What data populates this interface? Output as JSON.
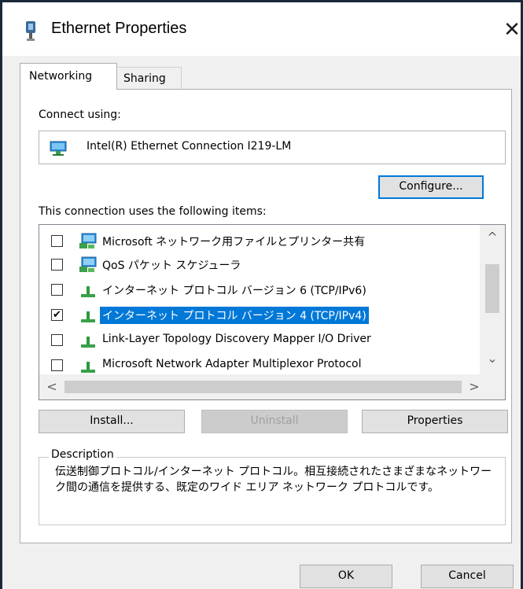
{
  "window": {
    "title": "Ethernet Properties",
    "close_glyph": "✕"
  },
  "tabs": [
    {
      "label": "Networking",
      "active": true
    },
    {
      "label": "Sharing",
      "active": false
    }
  ],
  "connect_using": {
    "label": "Connect using:",
    "adapter_name": "Intel(R) Ethernet Connection I219-LM",
    "adapter_icon": "network-adapter-icon",
    "configure_label": "Configure..."
  },
  "items_section": {
    "label": "This connection uses the following items:",
    "items": [
      {
        "label": "Microsoft ネットワーク用ファイルとプリンター共有",
        "checked": false,
        "icon": "network-service-icon",
        "selected": false
      },
      {
        "label": "QoS パケット スケジューラ",
        "checked": false,
        "icon": "network-service-icon",
        "selected": false
      },
      {
        "label": "インターネット プロトコル バージョン 6 (TCP/IPv6)",
        "checked": false,
        "icon": "protocol-icon",
        "selected": false
      },
      {
        "label": "インターネット プロトコル バージョン 4 (TCP/IPv4)",
        "checked": true,
        "icon": "protocol-icon",
        "selected": true
      },
      {
        "label": "Link-Layer Topology Discovery Mapper I/O Driver",
        "checked": false,
        "icon": "protocol-icon",
        "selected": false
      },
      {
        "label": "Microsoft Network Adapter Multiplexor Protocol",
        "checked": false,
        "icon": "protocol-icon",
        "selected": false
      }
    ],
    "check_glyph": "✔",
    "scroll_up_glyph": "^",
    "scroll_down_glyph": "⌄",
    "scroll_left_glyph": "<",
    "scroll_right_glyph": ">"
  },
  "actions": {
    "install_label": "Install...",
    "uninstall_label": "Uninstall",
    "properties_label": "Properties"
  },
  "description": {
    "legend": "Description",
    "text": "伝送制御プロトコル/インターネット プロトコル。相互接続されたさまざまなネットワーク間の通信を提供する、既定のワイド エリア ネットワーク プロトコルです。"
  },
  "footer": {
    "ok_label": "OK",
    "cancel_label": "Cancel"
  },
  "colors": {
    "selection": "#0078d7",
    "default_button_border": "#0078d7",
    "window_border": "#1a2a3a"
  }
}
